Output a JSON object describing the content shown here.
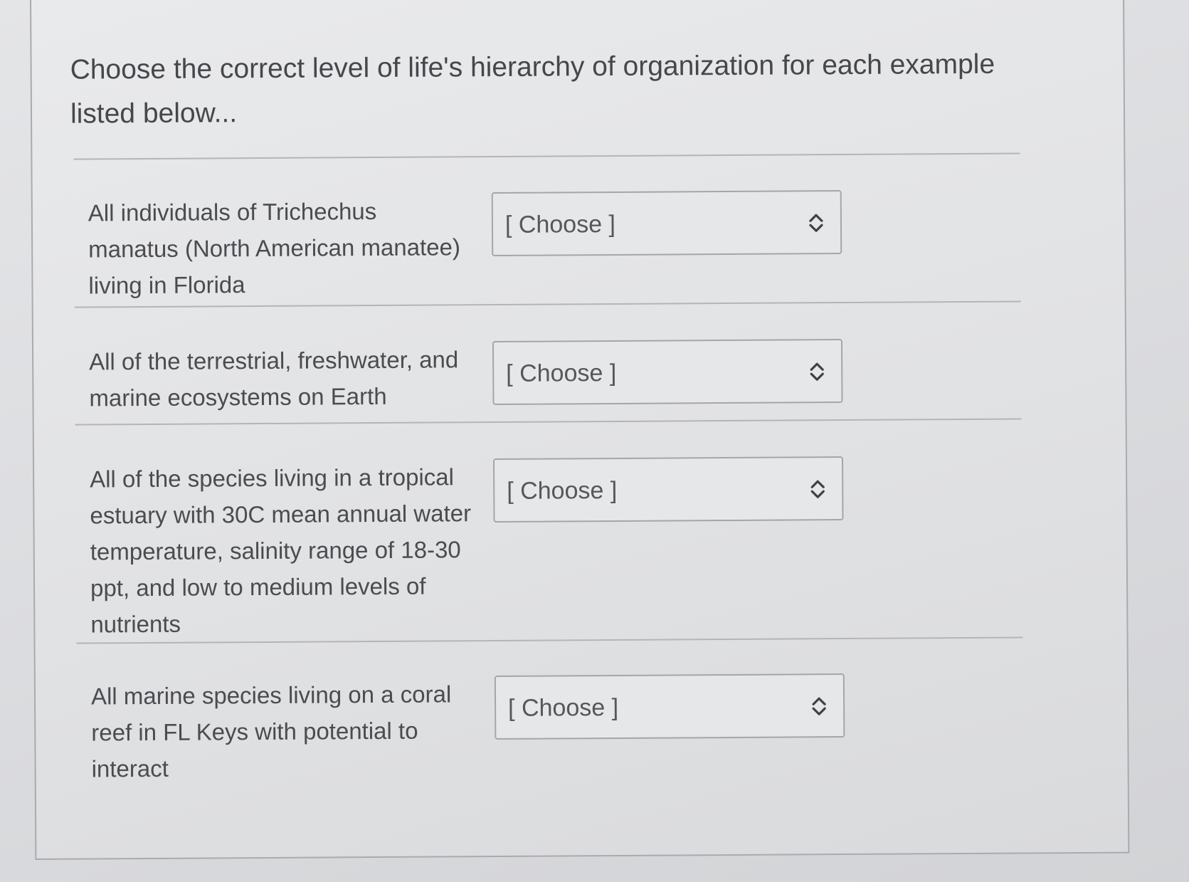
{
  "question": {
    "prompt": "Choose the correct level of life's hierarchy of organization for each example listed below..."
  },
  "rows": [
    {
      "example": "All individuals of Trichechus manatus (North American manatee) living in Florida",
      "selected": "[ Choose ]"
    },
    {
      "example": "All of the terrestrial, freshwater, and marine ecosystems on Earth",
      "selected": "[ Choose ]"
    },
    {
      "example": "All of the species living in a tropical estuary with 30C mean annual water temperature, salinity range of 18-30 ppt, and low to medium levels of nutrients",
      "selected": "[ Choose ]"
    },
    {
      "example": "All marine species living on a coral reef in FL Keys with potential to interact",
      "selected": "[ Choose ]"
    }
  ],
  "icons": {
    "dropdown": "up-down-chevron-icon"
  },
  "colors": {
    "text": "#4a4c50",
    "border": "#a4a6a9",
    "background": "#e3e4e6"
  }
}
